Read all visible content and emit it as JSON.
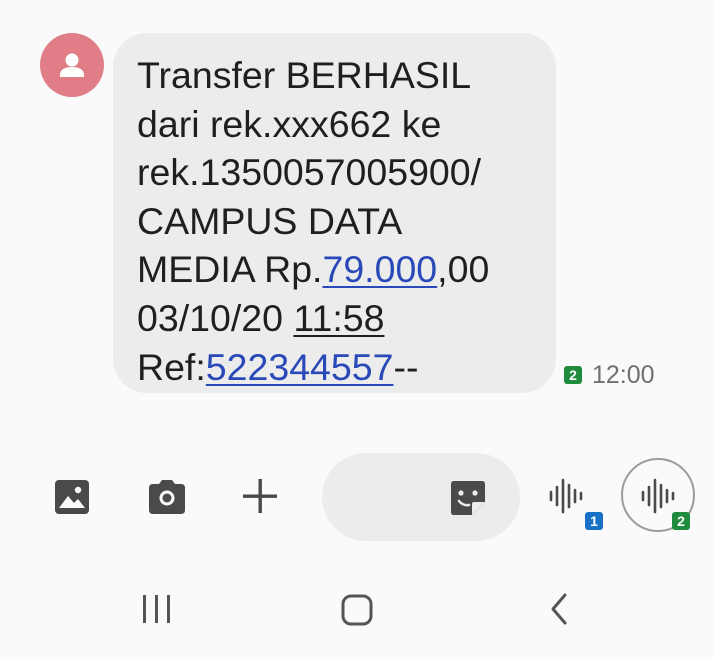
{
  "message": {
    "line1": "Transfer BERHASIL",
    "line2": "dari rek.xxx662 ke",
    "line3": "rek.1350057005900/",
    "line4": "CAMPUS DATA",
    "line5_prefix": "MEDIA Rp.",
    "amount_link": "79.000",
    "line5_suffix": ",00",
    "date_text": "03/10/20 ",
    "time_text": "11:58",
    "ref_prefix": "Ref:",
    "ref_link": "522344557",
    "ref_suffix": "--"
  },
  "meta": {
    "sim": "2",
    "time": "12:00"
  },
  "compose": {
    "voice_sim_1": "1",
    "voice_sim_2": "2"
  },
  "icons": {
    "avatar": "person-icon",
    "gallery": "gallery-icon",
    "camera": "camera-icon",
    "add": "plus-icon",
    "sticker": "sticker-icon",
    "voice": "voice-wave-icon",
    "recents": "recents-icon",
    "home": "home-icon",
    "back": "back-icon"
  },
  "colors": {
    "avatar": "#e07d86",
    "bubble": "#ececec",
    "link": "#2a49b8",
    "sim_green": "#1f8c3d",
    "sim_blue": "#1871c4"
  }
}
